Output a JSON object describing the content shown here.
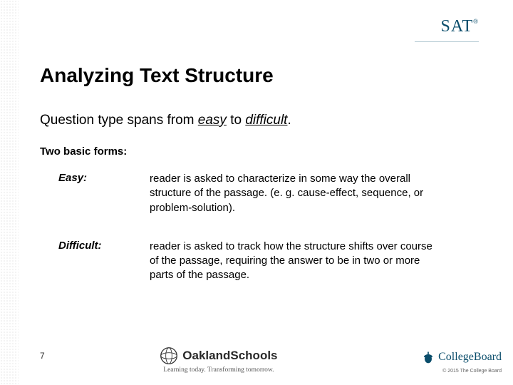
{
  "header": {
    "logo": "SAT",
    "logo_mark": "®"
  },
  "main": {
    "title": "Analyzing Text Structure",
    "subtitle_pre": "Question type spans from ",
    "subtitle_easy": "easy",
    "subtitle_mid": " to ",
    "subtitle_difficult": "difficult",
    "subtitle_post": ".",
    "forms_label": "Two basic forms:",
    "rows": [
      {
        "label": "Easy:",
        "desc": "reader is asked to characterize in some way the overall structure of the passage. (e. g. cause-effect, sequence, or problem-solution)."
      },
      {
        "label": "Difficult:",
        "desc": "reader is asked to track how the structure shifts over course of the passage, requiring the answer to be in two or more parts of the passage."
      }
    ]
  },
  "footer": {
    "page_number": "7",
    "oakland_name": "OaklandSchools",
    "oakland_tagline": "Learning today. Transforming tomorrow.",
    "collegeboard": "CollegeBoard",
    "copyright": "© 2015 The College Board"
  }
}
